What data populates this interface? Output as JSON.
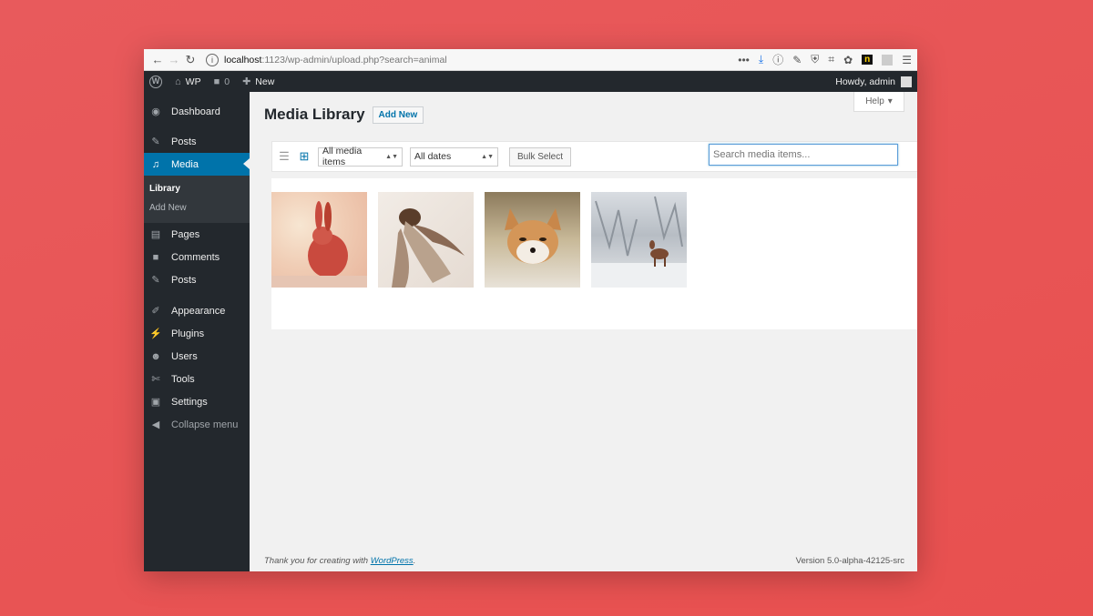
{
  "browser": {
    "url_host": "localhost",
    "url_rest": ":1123/wp-admin/upload.php?search=animal"
  },
  "adminbar": {
    "site_name": "WP",
    "comments_count": "0",
    "new_label": "New",
    "greeting": "Howdy, admin"
  },
  "sidebar": {
    "items": [
      {
        "label": "Dashboard",
        "icon": "dashboard-icon"
      },
      {
        "label": "Posts",
        "icon": "pin-icon"
      },
      {
        "label": "Media",
        "icon": "media-icon"
      },
      {
        "label": "Pages",
        "icon": "pages-icon"
      },
      {
        "label": "Comments",
        "icon": "comment-icon"
      },
      {
        "label": "Posts",
        "icon": "pin-icon"
      },
      {
        "label": "Appearance",
        "icon": "brush-icon"
      },
      {
        "label": "Plugins",
        "icon": "plug-icon"
      },
      {
        "label": "Users",
        "icon": "user-icon"
      },
      {
        "label": "Tools",
        "icon": "wrench-icon"
      },
      {
        "label": "Settings",
        "icon": "settings-icon"
      }
    ],
    "submenu": [
      "Library",
      "Add New"
    ],
    "collapse_label": "Collapse menu"
  },
  "main": {
    "title": "Media Library",
    "add_new": "Add New",
    "help": "Help",
    "filter_type": "All media items",
    "filter_date": "All dates",
    "bulk_select": "Bulk Select",
    "search_placeholder": "Search media items...",
    "thumbnails": [
      {
        "subject": "rabbit"
      },
      {
        "subject": "afghan-hound"
      },
      {
        "subject": "fox"
      },
      {
        "subject": "deer"
      }
    ]
  },
  "footer": {
    "thanks_prefix": "Thank you for creating with ",
    "thanks_link": "WordPress",
    "thanks_suffix": ".",
    "version": "Version 5.0-alpha-42125-src"
  },
  "colors": {
    "accent": "#0073aa",
    "sidebar_bg": "#23282d",
    "background": "#e85a5c"
  }
}
